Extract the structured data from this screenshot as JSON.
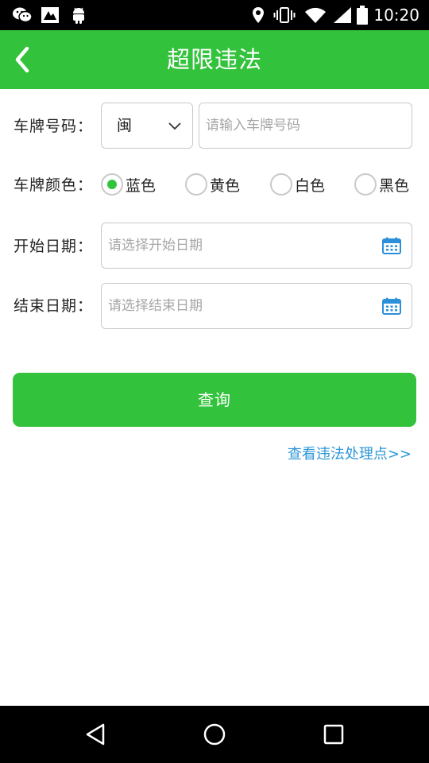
{
  "status_bar": {
    "time": "10:20",
    "left_icons": [
      "wechat-icon",
      "image-notification-icon",
      "android-icon"
    ],
    "right_icons": [
      "location-icon",
      "vibrate-icon",
      "wifi-icon",
      "signal-icon",
      "battery-icon"
    ]
  },
  "header": {
    "title": "超限违法",
    "back_icon": "back-arrow-icon"
  },
  "form": {
    "plate_label": "车牌号码：",
    "province_value": "闽",
    "plate_placeholder": "请输入车牌号码",
    "color_label": "车牌颜色：",
    "colors": [
      {
        "label": "蓝色",
        "selected": true
      },
      {
        "label": "黄色",
        "selected": false
      },
      {
        "label": "白色",
        "selected": false
      },
      {
        "label": "黑色",
        "selected": false
      }
    ],
    "start_label": "开始日期：",
    "start_placeholder": "请选择开始日期",
    "end_label": "结束日期：",
    "end_placeholder": "请选择结束日期"
  },
  "actions": {
    "query_label": "查询",
    "view_points_link": "查看违法处理点>>"
  },
  "nav_bar": {
    "icons": [
      "back-triangle-icon",
      "home-circle-icon",
      "recents-square-icon"
    ]
  },
  "colors": {
    "brand_green": "#33c23b",
    "link_blue": "#2c97d9",
    "calendar_blue": "#2c8fd9"
  }
}
